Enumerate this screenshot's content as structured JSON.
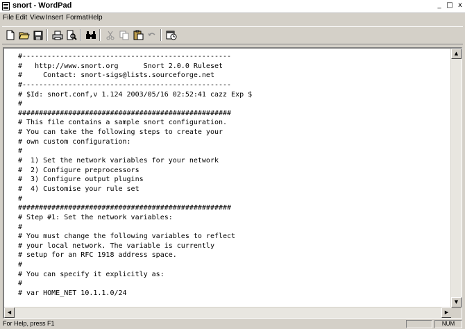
{
  "window": {
    "title": "snort - WordPad",
    "min_glyph": "_",
    "max_glyph": "□",
    "close_glyph": "x"
  },
  "menu": [
    {
      "label": "File"
    },
    {
      "label": "Edit"
    },
    {
      "label": "View"
    },
    {
      "label": "Insert"
    },
    {
      "label": "Format"
    },
    {
      "label": "Help"
    }
  ],
  "toolbar": {
    "buttons": [
      "new-icon",
      "open-icon",
      "save-icon",
      "print-icon",
      "print-preview-icon",
      "find-icon",
      "cut-icon",
      "copy-icon",
      "paste-icon",
      "undo-icon",
      "date-time-icon"
    ]
  },
  "document": {
    "lines": [
      "#--------------------------------------------------",
      "#   http://www.snort.org      Snort 2.0.0 Ruleset",
      "#     Contact: snort-sigs@lists.sourceforge.net",
      "#--------------------------------------------------",
      "# $Id: snort.conf,v 1.124 2003/05/16 02:52:41 cazz Exp $",
      "#",
      "###################################################",
      "# This file contains a sample snort configuration.",
      "# You can take the following steps to create your",
      "# own custom configuration:",
      "#",
      "#  1) Set the network variables for your network",
      "#  2) Configure preprocessors",
      "#  3) Configure output plugins",
      "#  4) Customise your rule set",
      "#",
      "###################################################",
      "# Step #1: Set the network variables:",
      "#",
      "# You must change the following variables to reflect",
      "# your local network. The variable is currently",
      "# setup for an RFC 1918 address space.",
      "#",
      "# You can specify it explicitly as:",
      "#",
      "# var HOME_NET 10.1.1.0/24"
    ]
  },
  "scrollbars": {
    "up_glyph": "▲",
    "down_glyph": "▼",
    "left_glyph": "◀",
    "right_glyph": "▶"
  },
  "status": {
    "text": "For Help, press F1",
    "num": "NUM"
  }
}
